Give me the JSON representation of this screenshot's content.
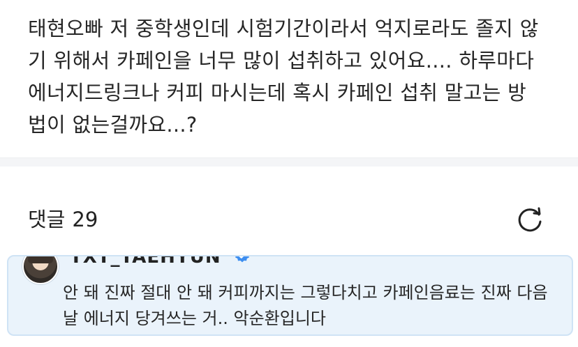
{
  "post": {
    "body_lines": [
      "태현오빠 저 중학생인데 시험기간이라서 억지로라도 졸지 않",
      "기 위해서 카페인을 너무 많이 섭취하고 있어요.... 하루마다",
      "에너지드링크나 커피 마시는데 혹시 카페인 섭취 말고는 방",
      "법이 없는걸까요...?"
    ]
  },
  "comments": {
    "label": "댓글",
    "count": "29",
    "refresh_icon": "refresh-icon"
  },
  "comment": {
    "author": "TXT_TAEHYUN",
    "verified_icon": "verified-badge-icon",
    "text_lines": [
      "안 돼 진짜 절대 안 돼 커피까지는 그렇다치고 카페인음료는 진짜 다음",
      "날 에너지 당겨쓰는 거.. 악순환입니다"
    ],
    "highlight_color": "#eaf3fb",
    "verified_color": "#3d8ef0"
  }
}
